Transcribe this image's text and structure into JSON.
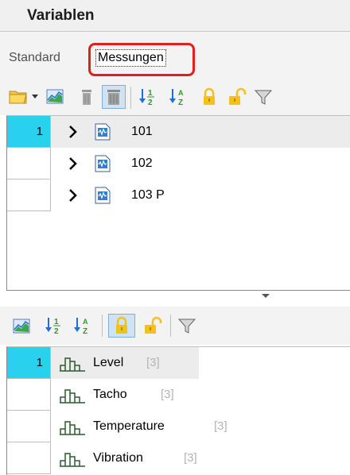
{
  "panel": {
    "title": "Variablen"
  },
  "tabs": [
    {
      "label": "Standard",
      "active": false
    },
    {
      "label": "Messungen",
      "active": true
    }
  ],
  "toolbar_top": {
    "icons": [
      "folder-icon",
      "dropdown-arrow-icon",
      "chart-icon",
      "trash-icon",
      "trash-all-icon",
      "sort-ascending-icon",
      "sort-descending-icon",
      "lock-icon",
      "unlock-icon",
      "filter-icon"
    ]
  },
  "measurements": [
    {
      "row": "1",
      "label": "101",
      "selected": true
    },
    {
      "row": "",
      "label": "102",
      "selected": false
    },
    {
      "row": "",
      "label": "103 P",
      "selected": false
    }
  ],
  "toolbar_bottom": {
    "icons": [
      "chart-icon",
      "sort-ascending-icon",
      "sort-descending-icon",
      "lock-icon",
      "unlock-icon",
      "filter-icon"
    ]
  },
  "variables": [
    {
      "row": "1",
      "label": "Level",
      "count": "[3]",
      "selected": true
    },
    {
      "row": "",
      "label": "Tacho",
      "count": "[3]",
      "selected": false
    },
    {
      "row": "",
      "label": "Temperature",
      "count": "[3]",
      "selected": false
    },
    {
      "row": "",
      "label": "Vibration",
      "count": "[3]",
      "selected": false
    }
  ],
  "colors": {
    "active_row_marker": "#29d1ef",
    "highlight_ring": "#e0201c",
    "sort_icon_blue": "#1e6fd6",
    "sort_icon_green": "#2a9a2a",
    "lock_yellow": "#f2c21a"
  }
}
